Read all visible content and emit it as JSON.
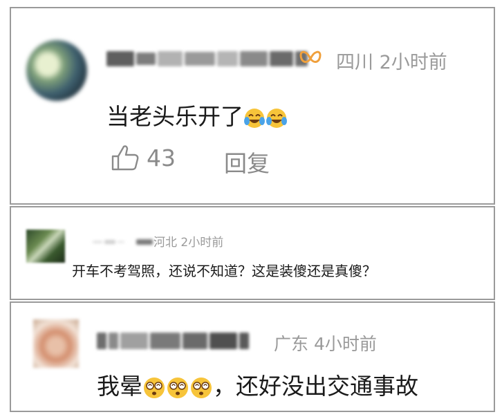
{
  "comments": [
    {
      "location": "四川",
      "time": "2小时前",
      "text": "当老头乐开了",
      "emoji_icons": [
        "laugh-cry-emoji",
        "laugh-cry-emoji"
      ],
      "badge_icon": "vip-butterfly-icon",
      "like_count": "43",
      "reply_label": "回复"
    },
    {
      "location": "河北",
      "time": "2小时前",
      "text": "开车不考驾照，还说不知道？这是装傻还是真傻？"
    },
    {
      "location": "广东",
      "time": "4小时前",
      "text_before": "我晕",
      "emoji_icons": [
        "dizzy-face-emoji",
        "dizzy-face-emoji",
        "dizzy-face-emoji"
      ],
      "text_after": "，还好没出交通事故"
    }
  ],
  "colors": {
    "border": "#9a9a9a",
    "meta_gray": "#9a9a9a",
    "text": "#1a1a1a",
    "vip_orange": "#f0a03c",
    "emoji_yellow": "#f7c43a"
  }
}
